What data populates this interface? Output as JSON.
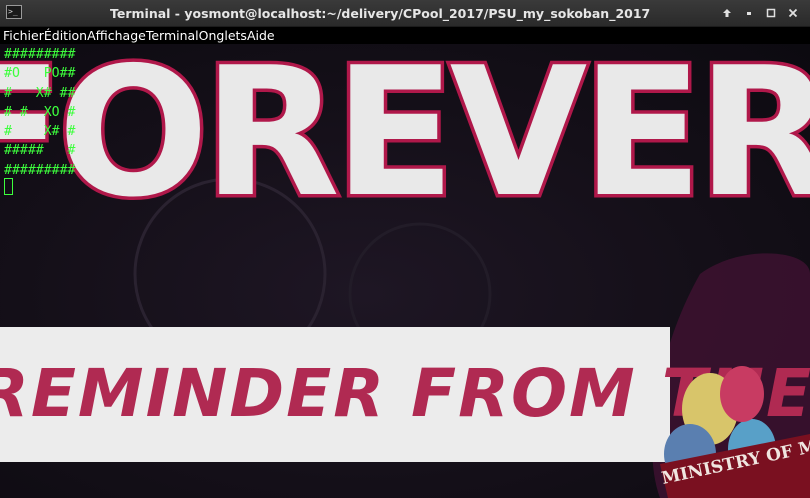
{
  "window": {
    "title": "Terminal - yosmont@localhost:~/delivery/CPool_2017/PSU_my_sokoban_2017",
    "icon": "terminal-icon",
    "buttons": [
      "arrow-up-icon",
      "minimize-icon",
      "maximize-icon",
      "close-icon"
    ]
  },
  "menubar": {
    "items": [
      "Fichier",
      "Édition",
      "Affichage",
      "Terminal",
      "Onglets",
      "Aide"
    ]
  },
  "terminal": {
    "lines": [
      "#########",
      "#O   PO##",
      "#   X# ##",
      "# #  XO #",
      "#    X# #",
      "#####   #",
      "#########"
    ],
    "text_color": "#3dff3d"
  },
  "wallpaper": {
    "headline": "FOREVER",
    "banner": "REMINDER FROM THE",
    "logo_text": "MINISTRY OF M",
    "colors": {
      "letters": "#e9e9e9",
      "outline": "#b0184a",
      "banner_text": "#b02a52"
    }
  }
}
